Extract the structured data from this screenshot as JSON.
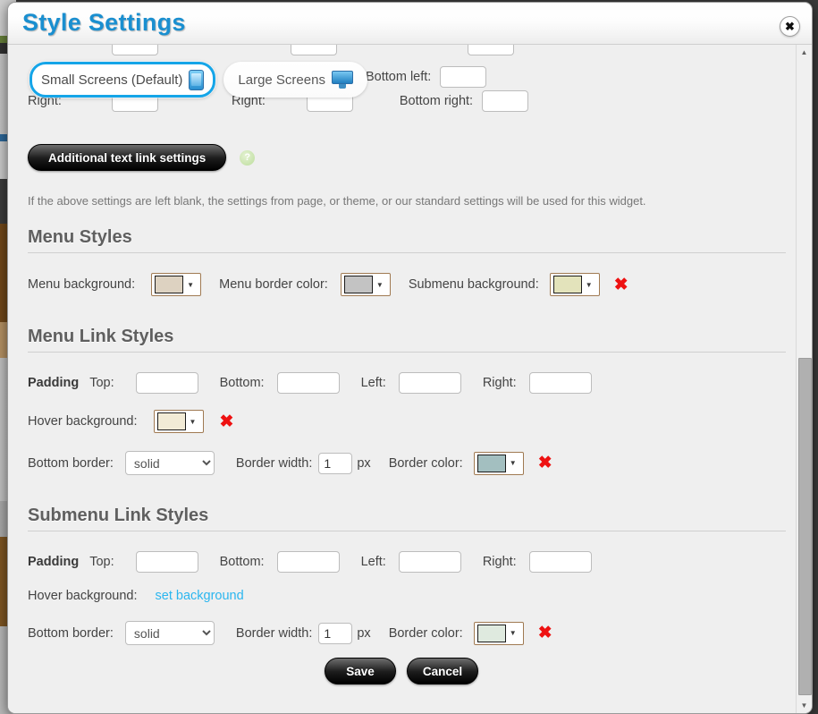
{
  "dialog": {
    "title": "Style Settings",
    "close_icon": "close-icon"
  },
  "tabs": [
    {
      "label": "Small Screens (Default)",
      "icon": "mobile-phone-icon",
      "active": true
    },
    {
      "label": "Large Screens",
      "icon": "desktop-monitor-icon",
      "active": false
    }
  ],
  "top_partial": {
    "right_label_1": "Right:",
    "right_value_1": "",
    "right_label_2": "Right:",
    "right_value_2": "",
    "bottom_left_label": "Bottom left:",
    "bottom_left_value": "",
    "bottom_right_label": "Bottom right:",
    "bottom_right_value": ""
  },
  "additional": {
    "button_label": "Additional text link settings",
    "help_icon": "help-question-icon",
    "help_glyph": "?",
    "hint": "If the above settings are left blank, the settings from page, or theme, or our standard settings will be used for this widget."
  },
  "menu_styles": {
    "heading": "Menu Styles",
    "menu_background_label": "Menu background:",
    "menu_background_color": "#ddd2c1",
    "menu_border_label": "Menu border color:",
    "menu_border_color": "#c3c3c3",
    "submenu_background_label": "Submenu background:",
    "submenu_background_color": "#e3e3bb",
    "clear_glyph": "✖"
  },
  "menu_link_styles": {
    "heading": "Menu Link Styles",
    "padding_label": "Padding",
    "top_label": "Top:",
    "top_value": "",
    "bottom_label": "Bottom:",
    "bottom_value": "",
    "left_label": "Left:",
    "left_value": "",
    "right_label": "Right:",
    "right_value": "",
    "hover_background_label": "Hover background:",
    "hover_background_color": "#f2ebd6",
    "bottom_border_label": "Bottom border:",
    "bottom_border_value": "solid",
    "bottom_border_options": [
      "solid"
    ],
    "border_width_label": "Border width:",
    "border_width_value": "1",
    "border_width_unit": "px",
    "border_color_label": "Border color:",
    "border_color": "#a3bfc0",
    "clear_glyph": "✖"
  },
  "submenu_link_styles": {
    "heading": "Submenu Link Styles",
    "padding_label": "Padding",
    "top_label": "Top:",
    "top_value": "",
    "bottom_label": "Bottom:",
    "bottom_value": "",
    "left_label": "Left:",
    "left_value": "",
    "right_label": "Right:",
    "right_value": "",
    "hover_background_label": "Hover background:",
    "hover_background_link": "set background",
    "bottom_border_label": "Bottom border:",
    "bottom_border_value": "solid",
    "bottom_border_options": [
      "solid"
    ],
    "border_width_label": "Border width:",
    "border_width_value": "1",
    "border_width_unit": "px",
    "border_color_label": "Border color:",
    "border_color": "#dfeadf",
    "clear_glyph": "✖"
  },
  "footer": {
    "save_label": "Save",
    "cancel_label": "Cancel"
  },
  "scrollbar": {
    "up_glyph": "▲",
    "down_glyph": "▼"
  }
}
